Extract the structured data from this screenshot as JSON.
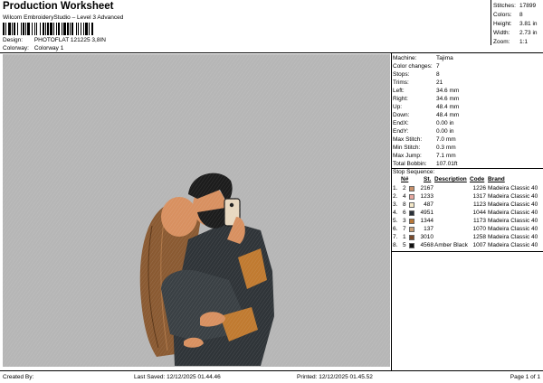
{
  "header": {
    "title": "Production Worksheet",
    "software": "Wilcom EmbroideryStudio – Level 3 Advanced",
    "design_label": "Design:",
    "design_value": "PHOTOFLAT 121225 3,8IN",
    "colorway_label": "Colorway:",
    "colorway_value": "Colorway 1"
  },
  "stats": [
    {
      "label": "Stitches:",
      "value": "17899"
    },
    {
      "label": "Colors:",
      "value": "8"
    },
    {
      "label": "Height:",
      "value": "3.81 in"
    },
    {
      "label": "Width:",
      "value": "2.73 in"
    },
    {
      "label": "Zoom:",
      "value": "1:1"
    }
  ],
  "machine_info": [
    {
      "label": "Machine:",
      "value": "Tajima"
    },
    {
      "label": "Color changes:",
      "value": "7"
    },
    {
      "label": "Stops:",
      "value": "8"
    },
    {
      "label": "Trims:",
      "value": "21"
    },
    {
      "label": "Left:",
      "value": "34.6 mm"
    },
    {
      "label": "Right:",
      "value": "34.6 mm"
    },
    {
      "label": "Up:",
      "value": "48.4 mm"
    },
    {
      "label": "Down:",
      "value": "48.4 mm"
    },
    {
      "label": "EndX:",
      "value": "0.00 in"
    },
    {
      "label": "EndY:",
      "value": "0.00 in"
    },
    {
      "label": "Max Stitch:",
      "value": "7.0 mm"
    },
    {
      "label": "Min Stitch:",
      "value": "0.3 mm"
    },
    {
      "label": "Max Jump:",
      "value": "7.1 mm"
    },
    {
      "label": "Total Bobbin:",
      "value": "107.01ft"
    }
  ],
  "stop_sequence": {
    "title": "Stop Sequence:",
    "headers": {
      "n": "N#",
      "st": "St.",
      "desc": "Description",
      "code": "Code",
      "brand": "Brand"
    },
    "rows": [
      {
        "stop": "1.",
        "n": "2",
        "color": "#c8906a",
        "st": "2167",
        "desc": "",
        "code": "1226",
        "brand": "Madeira Classic 40"
      },
      {
        "stop": "2.",
        "n": "4",
        "color": "#e8a8a0",
        "st": "1233",
        "desc": "",
        "code": "1317",
        "brand": "Madeira Classic 40"
      },
      {
        "stop": "3.",
        "n": "8",
        "color": "#f4e8c8",
        "st": "487",
        "desc": "",
        "code": "1123",
        "brand": "Madeira Classic 40"
      },
      {
        "stop": "4.",
        "n": "6",
        "color": "#2a3038",
        "st": "4951",
        "desc": "",
        "code": "1044",
        "brand": "Madeira Classic 40"
      },
      {
        "stop": "5.",
        "n": "3",
        "color": "#b87838",
        "st": "1344",
        "desc": "",
        "code": "1173",
        "brand": "Madeira Classic 40"
      },
      {
        "stop": "6.",
        "n": "7",
        "color": "#c8a078",
        "st": "137",
        "desc": "",
        "code": "1070",
        "brand": "Madeira Classic 40"
      },
      {
        "stop": "7.",
        "n": "1",
        "color": "#7a4a2a",
        "st": "3010",
        "desc": "",
        "code": "1258",
        "brand": "Madeira Classic 40"
      },
      {
        "stop": "8.",
        "n": "5",
        "color": "#101010",
        "st": "4568",
        "desc": "Amber Black",
        "code": "1007",
        "brand": "Madeira Classic 40"
      }
    ]
  },
  "footer": {
    "created_by": "Created By:",
    "last_saved": "Last Saved: 12/12/2025 01.44.46",
    "printed": "Printed: 12/12/2025 01.45.52",
    "page": "Page 1 of 1"
  },
  "colors": {
    "canvas_bg": "#b6b6b6",
    "jacket": "#2f3438",
    "hair_woman": "#8a5a32",
    "hair_man": "#1c1c1c",
    "skin": "#d89060",
    "accent_orange": "#c07a30"
  }
}
